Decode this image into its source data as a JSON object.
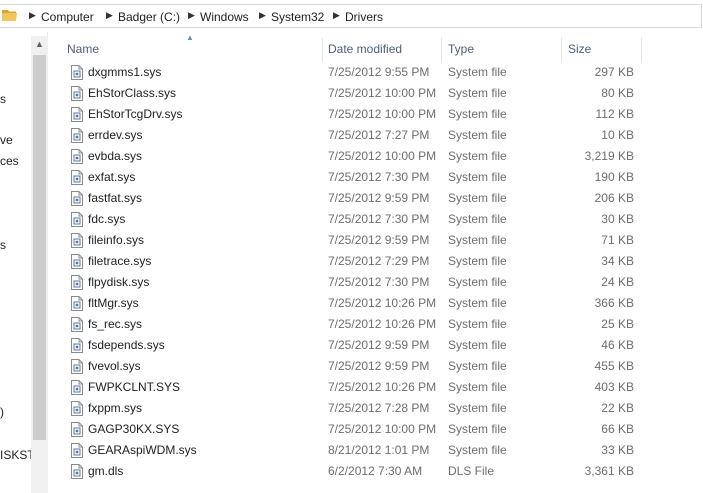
{
  "address": {
    "crumbs": [
      "Computer",
      "Badger (C:)",
      "Windows",
      "System32",
      "Drivers"
    ]
  },
  "nav": {
    "fragments": [
      "s",
      "ve",
      "ces",
      "s",
      ")",
      "ISKST"
    ]
  },
  "columns": {
    "name": "Name",
    "date": "Date modified",
    "type": "Type",
    "size": "Size"
  },
  "files": [
    {
      "name": "dxgmms1.sys",
      "date": "7/25/2012 9:55 PM",
      "type": "System file",
      "size": "297 KB"
    },
    {
      "name": "EhStorClass.sys",
      "date": "7/25/2012 10:00 PM",
      "type": "System file",
      "size": "80 KB"
    },
    {
      "name": "EhStorTcgDrv.sys",
      "date": "7/25/2012 10:00 PM",
      "type": "System file",
      "size": "112 KB"
    },
    {
      "name": "errdev.sys",
      "date": "7/25/2012 7:27 PM",
      "type": "System file",
      "size": "10 KB"
    },
    {
      "name": "evbda.sys",
      "date": "7/25/2012 10:00 PM",
      "type": "System file",
      "size": "3,219 KB"
    },
    {
      "name": "exfat.sys",
      "date": "7/25/2012 7:30 PM",
      "type": "System file",
      "size": "190 KB"
    },
    {
      "name": "fastfat.sys",
      "date": "7/25/2012 9:59 PM",
      "type": "System file",
      "size": "206 KB"
    },
    {
      "name": "fdc.sys",
      "date": "7/25/2012 7:30 PM",
      "type": "System file",
      "size": "30 KB"
    },
    {
      "name": "fileinfo.sys",
      "date": "7/25/2012 9:59 PM",
      "type": "System file",
      "size": "71 KB"
    },
    {
      "name": "filetrace.sys",
      "date": "7/25/2012 7:29 PM",
      "type": "System file",
      "size": "34 KB"
    },
    {
      "name": "flpydisk.sys",
      "date": "7/25/2012 7:30 PM",
      "type": "System file",
      "size": "24 KB"
    },
    {
      "name": "fltMgr.sys",
      "date": "7/25/2012 10:26 PM",
      "type": "System file",
      "size": "366 KB"
    },
    {
      "name": "fs_rec.sys",
      "date": "7/25/2012 10:26 PM",
      "type": "System file",
      "size": "25 KB"
    },
    {
      "name": "fsdepends.sys",
      "date": "7/25/2012 9:59 PM",
      "type": "System file",
      "size": "46 KB"
    },
    {
      "name": "fvevol.sys",
      "date": "7/25/2012 9:59 PM",
      "type": "System file",
      "size": "455 KB"
    },
    {
      "name": "FWPKCLNT.SYS",
      "date": "7/25/2012 10:26 PM",
      "type": "System file",
      "size": "403 KB"
    },
    {
      "name": "fxppm.sys",
      "date": "7/25/2012 7:28 PM",
      "type": "System file",
      "size": "22 KB"
    },
    {
      "name": "GAGP30KX.SYS",
      "date": "7/25/2012 10:00 PM",
      "type": "System file",
      "size": "66 KB"
    },
    {
      "name": "GEARAspiWDM.sys",
      "date": "8/21/2012 1:01 PM",
      "type": "System file",
      "size": "33 KB"
    },
    {
      "name": "gm.dls",
      "date": "6/2/2012 7:30 AM",
      "type": "DLS File",
      "size": "3,361 KB"
    }
  ]
}
